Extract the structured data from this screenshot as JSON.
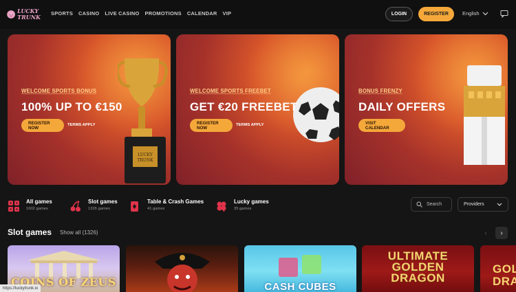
{
  "header": {
    "logo_text": "LUCKY TRUNK",
    "nav": [
      "SPORTS",
      "CASINO",
      "LIVE CASINO",
      "PROMOTIONS",
      "CALENDAR",
      "VIP"
    ],
    "login_label": "LOGIN",
    "register_label": "REGISTER",
    "language": "English"
  },
  "banners": [
    {
      "kicker": "WELCOME SPORTS BONUS",
      "headline": "100% UP TO €150",
      "cta": "REGISTER NOW",
      "terms": "TERMS APPLY",
      "art": "trophy"
    },
    {
      "kicker": "WELCOME SPORTS FREEBET",
      "headline": "GET €20 FREEBET",
      "cta": "REGISTER NOW",
      "terms": "TERMS APPLY",
      "art": "football"
    },
    {
      "kicker": "BONUS FRENZY",
      "headline": "DAILY OFFERS",
      "cta": "VISIT CALENDAR",
      "art": "gift-box"
    }
  ],
  "categories": [
    {
      "title": "All games",
      "count": "1602 games",
      "icon": "dice-icon"
    },
    {
      "title": "Slot games",
      "count": "1326 games",
      "icon": "cherry-icon"
    },
    {
      "title": "Table & Crash Games",
      "count": "41 games",
      "icon": "cards-icon"
    },
    {
      "title": "Lucky games",
      "count": "35 games",
      "icon": "clover-icon"
    }
  ],
  "filters": {
    "search_placeholder": "Search",
    "providers_label": "Providers"
  },
  "slot_section": {
    "title": "Slot games",
    "show_all": "Show all (1326)",
    "tiles": [
      "COINS OF ZEUS",
      "",
      "CASH CUBES",
      "ULTIMATE GOLDEN DRAGON",
      "GOLDEN DRAGON"
    ]
  },
  "status_url": "https://luckytrunk.io",
  "colors": {
    "accent": "#f5a83a",
    "background": "#151515",
    "banner_red": "#a6322a"
  }
}
